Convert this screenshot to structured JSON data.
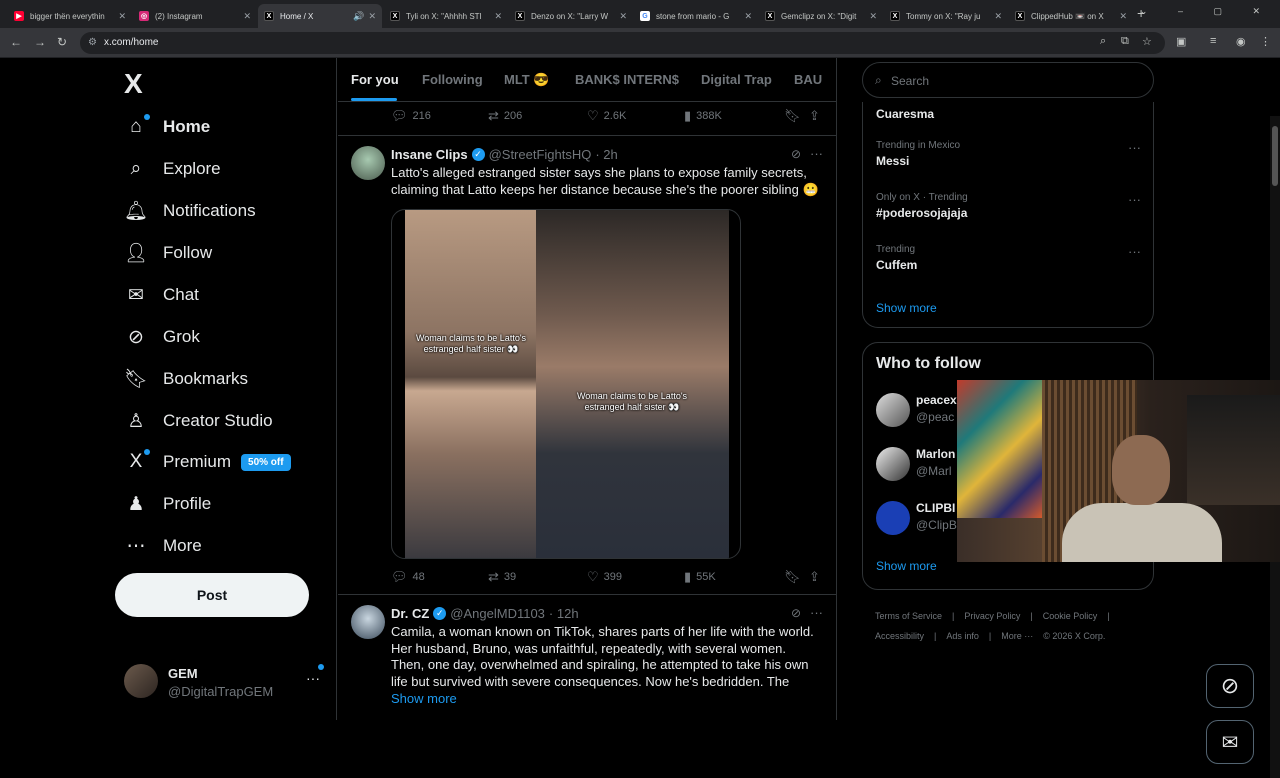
{
  "browser": {
    "tabs": [
      {
        "label": "bigger thën everythin",
        "favicon_color": "#ff0033",
        "favicon_glyph": "▶"
      },
      {
        "label": "(2) Instagram",
        "favicon_color": "#d62976",
        "favicon_glyph": "◎"
      },
      {
        "label": "Home / X",
        "favicon_color": "#000000",
        "favicon_glyph": "X",
        "active": true,
        "audio": "🔊"
      },
      {
        "label": "Tyli on X: \"Ahhhh STI",
        "favicon_color": "#000000",
        "favicon_glyph": "X"
      },
      {
        "label": "Denzo on X: \"Larry W",
        "favicon_color": "#000000",
        "favicon_glyph": "X"
      },
      {
        "label": "stone from mario - G",
        "favicon_color": "#4285f4",
        "favicon_glyph": "G"
      },
      {
        "label": "Gemclipz on X: \"Digit",
        "favicon_color": "#000000",
        "favicon_glyph": "X"
      },
      {
        "label": "Tommy on X: \"Ray ju",
        "favicon_color": "#000000",
        "favicon_glyph": "X"
      },
      {
        "label": "ClippedHub 📼 on X",
        "favicon_color": "#000000",
        "favicon_glyph": "X"
      }
    ],
    "url": "x.com/home"
  },
  "nav": {
    "logo": "X",
    "items": [
      {
        "label": "Home",
        "icon": "⌂",
        "active": true,
        "dot": true
      },
      {
        "label": "Explore",
        "icon": "⌕"
      },
      {
        "label": "Notifications",
        "icon": "🔔︎"
      },
      {
        "label": "Follow",
        "icon": "👤︎"
      },
      {
        "label": "Chat",
        "icon": "✉"
      },
      {
        "label": "Grok",
        "icon": "⊘"
      },
      {
        "label": "Bookmarks",
        "icon": "🔖︎"
      },
      {
        "label": "Creator Studio",
        "icon": "♙"
      },
      {
        "label": "Premium",
        "icon": "X",
        "dot": true,
        "badge": "50% off"
      },
      {
        "label": "Profile",
        "icon": "♟"
      },
      {
        "label": "More",
        "icon": "⋯"
      }
    ],
    "post_label": "Post",
    "account": {
      "name": "GEM",
      "handle": "@DigitalTrapGEM",
      "more": "···"
    }
  },
  "feed": {
    "tabs": [
      "For you",
      "Following",
      "MLT 😎",
      "BANK$ INTERN$",
      "Digital Trap",
      "BAU"
    ],
    "prev_actions": {
      "reply": "216",
      "repost": "206",
      "like": "2.6K",
      "views": "388K"
    },
    "tweet1": {
      "name": "Insane Clips",
      "handle": "@StreetFightsHQ",
      "time": "· 2h",
      "text": "Latto's alleged estranged sister says she plans to expose family secrets, claiming that Latto keeps her distance because she's the poorer sibling 😬",
      "caption_left": "Woman claims to be Latto's estranged half sister 👀",
      "caption_right": "Woman claims to be Latto's estranged half sister 👀",
      "actions": {
        "reply": "48",
        "repost": "39",
        "like": "399",
        "views": "55K"
      }
    },
    "tweet2": {
      "name": "Dr. CZ",
      "handle": "@AngelMD1103",
      "time": "· 12h",
      "text": "Camila, a woman known on TikTok, shares parts of her life with the world. Her husband, Bruno, was unfaithful, repeatedly, with several women. Then, one day, overwhelmed and spiraling, he attempted to take his own life but survived with severe consequences. Now he's bedridden. The",
      "show_more": "Show more"
    }
  },
  "right": {
    "search_placeholder": "Search",
    "trends": [
      {
        "context": "",
        "title": "Cuaresma"
      },
      {
        "context": "Trending in Mexico",
        "title": "Messi"
      },
      {
        "context": "Only on X · Trending",
        "title": "#poderosojajaja"
      },
      {
        "context": "Trending",
        "title": "Cuffem"
      }
    ],
    "show_more": "Show more",
    "who_to_follow": {
      "title": "Who to follow",
      "accounts": [
        {
          "name": "peacex",
          "handle": "@peac"
        },
        {
          "name": "Marlon",
          "handle": "@Marl"
        },
        {
          "name": "CLIPBI",
          "handle": "@ClipB"
        }
      ],
      "show_more": "Show more"
    },
    "footer": [
      "Terms of Service",
      "|",
      "Privacy Policy",
      "|",
      "Cookie Policy",
      "|",
      "Accessibility",
      "|",
      "Ads info",
      "|",
      "More ···",
      "© 2026 X Corp."
    ]
  }
}
